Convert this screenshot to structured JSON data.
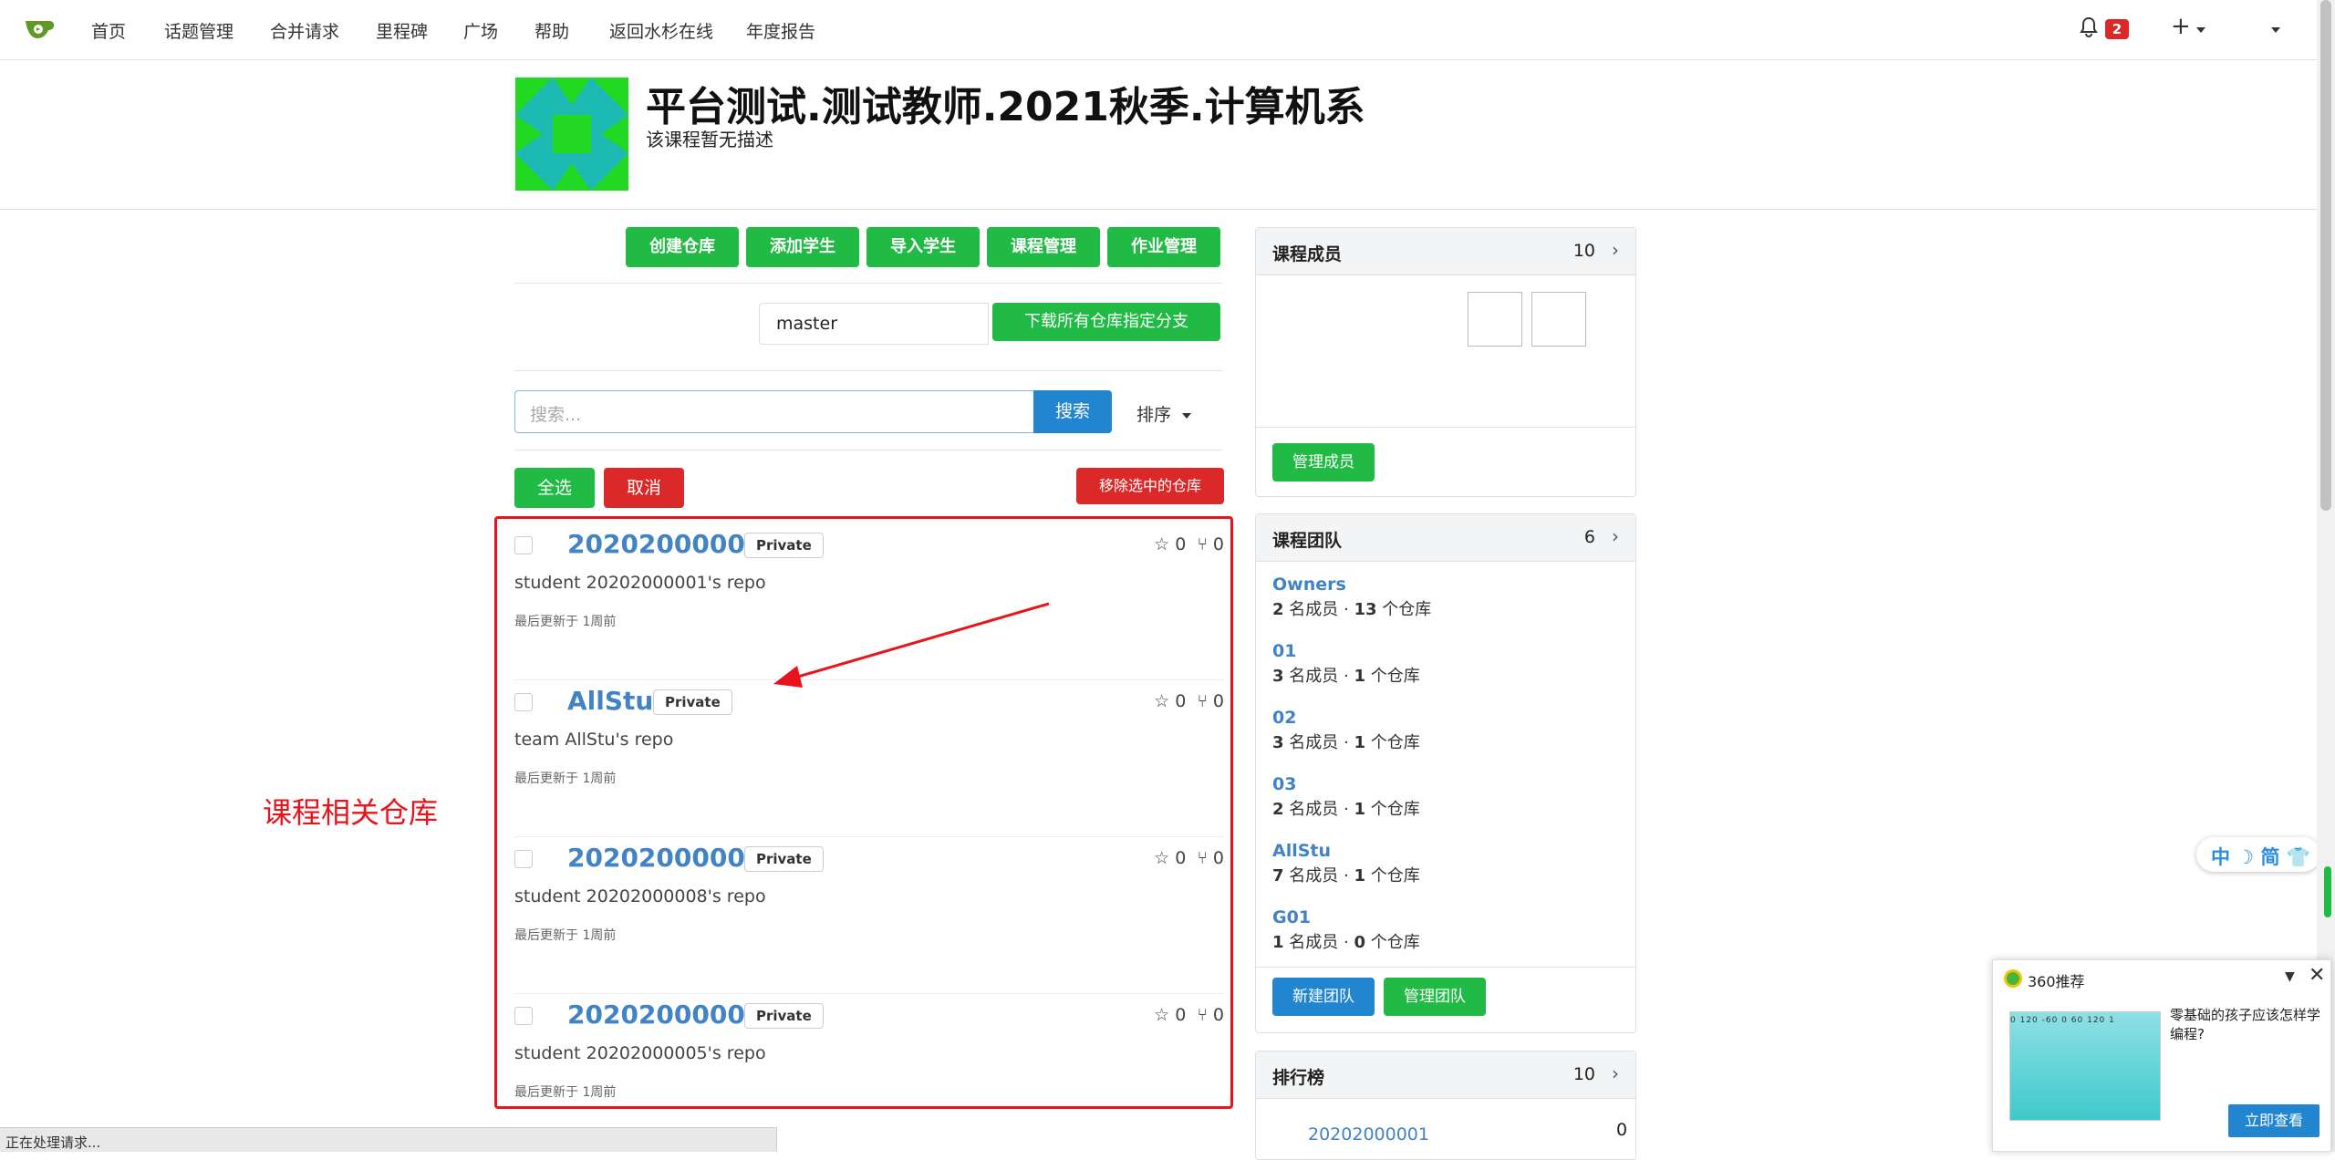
{
  "nav": {
    "items": [
      "首页",
      "话题管理",
      "合并请求",
      "里程碑",
      "广场",
      "帮助",
      "返回水杉在线",
      "年度报告"
    ],
    "notifications": "2",
    "plus": "+"
  },
  "header": {
    "title": "平台测试.测试教师.2021秋季.计算机系",
    "description": "该课程暂无描述"
  },
  "actions": {
    "create_repo": "创建仓库",
    "add_student": "添加学生",
    "import_student": "导入学生",
    "course_manage": "课程管理",
    "homework_manage": "作业管理"
  },
  "branch": {
    "value": "master",
    "download_label": "下载所有仓库指定分支"
  },
  "search": {
    "placeholder": "搜索...",
    "button": "搜索",
    "sort": "排序"
  },
  "selection": {
    "select_all": "全选",
    "cancel": "取消",
    "remove_selected": "移除选中的仓库"
  },
  "repos": [
    {
      "name": "20202000001",
      "badge": "Private",
      "stars": "0",
      "forks": "0",
      "desc": "student 20202000001's repo",
      "updated": "最后更新于 1周前"
    },
    {
      "name": "AllStu",
      "badge": "Private",
      "stars": "0",
      "forks": "0",
      "desc": "team AllStu's repo",
      "updated": "最后更新于 1周前"
    },
    {
      "name": "20202000008",
      "badge": "Private",
      "stars": "0",
      "forks": "0",
      "desc": "student 20202000008's repo",
      "updated": "最后更新于 1周前"
    },
    {
      "name": "20202000005",
      "badge": "Private",
      "stars": "0",
      "forks": "0",
      "desc": "student 20202000005's repo",
      "updated": "最后更新于 1周前"
    }
  ],
  "annotation": {
    "label": "课程相关仓库"
  },
  "members_panel": {
    "title": "课程成员",
    "count": "10",
    "manage": "管理成员"
  },
  "teams_panel": {
    "title": "课程团队",
    "count": "6",
    "teams": [
      {
        "name": "Owners",
        "members": "2",
        "repos": "13"
      },
      {
        "name": "01",
        "members": "3",
        "repos": "1"
      },
      {
        "name": "02",
        "members": "3",
        "repos": "1"
      },
      {
        "name": "03",
        "members": "2",
        "repos": "1"
      },
      {
        "name": "AllStu",
        "members": "7",
        "repos": "1"
      },
      {
        "name": "G01",
        "members": "1",
        "repos": "0"
      }
    ],
    "member_unit": "名成员",
    "repo_unit": "个仓库",
    "new_team": "新建团队",
    "manage_team": "管理团队"
  },
  "rank_panel": {
    "title": "排行榜",
    "count": "10",
    "first_name": "20202000001",
    "first_value": "0"
  },
  "ime": {
    "text": "中 ☽ 简 👕"
  },
  "ad": {
    "title": "360推荐",
    "text": "零基础的孩子应该怎样学编程?",
    "button": "立即查看",
    "ruler": "0  120  -60   0   60  120  1"
  },
  "statusbar": "正在处理请求..."
}
